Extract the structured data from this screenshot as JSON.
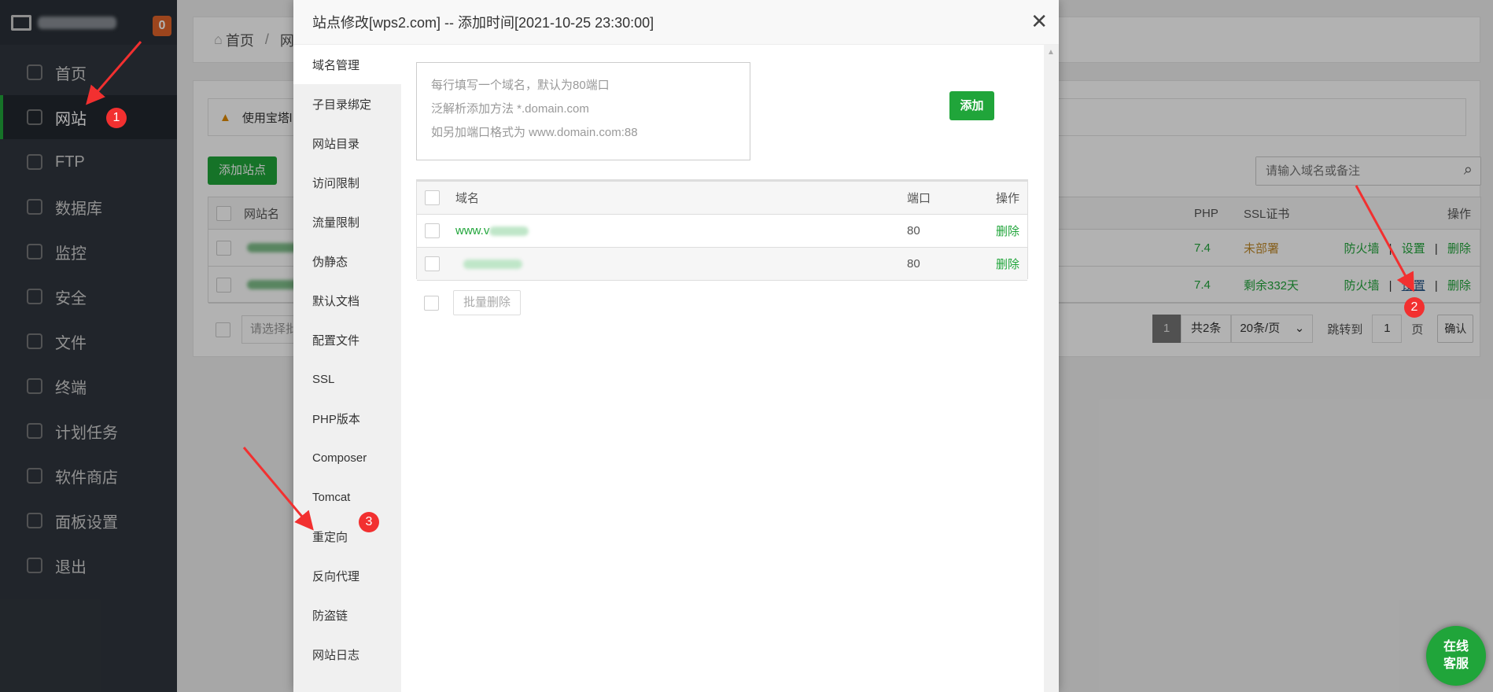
{
  "sidebar": {
    "badge": "0",
    "items": [
      {
        "label": "首页",
        "icon": "home-icon"
      },
      {
        "label": "网站",
        "icon": "globe-icon",
        "active": true
      },
      {
        "label": "FTP",
        "icon": "ftp-icon"
      },
      {
        "label": "数据库",
        "icon": "database-icon"
      },
      {
        "label": "监控",
        "icon": "monitor-icon"
      },
      {
        "label": "安全",
        "icon": "shield-icon"
      },
      {
        "label": "文件",
        "icon": "folder-icon"
      },
      {
        "label": "终端",
        "icon": "terminal-icon"
      },
      {
        "label": "计划任务",
        "icon": "calendar-icon"
      },
      {
        "label": "软件商店",
        "icon": "apps-icon"
      },
      {
        "label": "面板设置",
        "icon": "gear-icon"
      },
      {
        "label": "退出",
        "icon": "logout-icon"
      }
    ]
  },
  "breadcrumb": {
    "home": "首页",
    "sep": "/",
    "current": "网"
  },
  "main": {
    "warning": "使用宝塔l",
    "add_site": "添加站点",
    "search_placeholder": "请输入域名或备注",
    "columns": {
      "name": "网站名",
      "php": "PHP",
      "ssl": "SSL证书",
      "ops": "操作"
    },
    "rows": [
      {
        "php": "7.4",
        "ssl": "未部署",
        "ssl_color": "#c08a2a"
      },
      {
        "php": "7.4",
        "ssl": "剩余332天",
        "ssl_color": "#20a53a"
      }
    ],
    "ops": {
      "firewall": "防火墙",
      "settings": "设置",
      "delete": "删除",
      "sep": "|"
    },
    "batch_placeholder": "请选择批",
    "pagination": {
      "current": "1",
      "total": "共2条",
      "per_page": "20条/页",
      "jump": "跳转到",
      "page_value": "1",
      "page_unit": "页",
      "confirm": "确认"
    }
  },
  "modal": {
    "title": "站点修改[wps2.com] -- 添加时间[2021-10-25 23:30:00]",
    "tabs": [
      "域名管理",
      "子目录绑定",
      "网站目录",
      "访问限制",
      "流量限制",
      "伪静态",
      "默认文档",
      "配置文件",
      "SSL",
      "PHP版本",
      "Composer",
      "Tomcat",
      "重定向",
      "反向代理",
      "防盗链",
      "网站日志"
    ],
    "textarea_hint": [
      "每行填写一个域名，默认为80端口",
      "泛解析添加方法 *.domain.com",
      "如另加端口格式为 www.domain.com:88"
    ],
    "add_button": "添加",
    "columns": {
      "domain": "域名",
      "port": "端口",
      "ops": "操作"
    },
    "rows": [
      {
        "domain": "www.v",
        "port": "80",
        "delete": "删除"
      },
      {
        "domain": "",
        "port": "80",
        "delete": "删除"
      }
    ],
    "batch_delete": "批量删除"
  },
  "annotations": [
    "1",
    "2",
    "3"
  ],
  "chat": {
    "line1": "在线",
    "line2": "客服"
  },
  "colors": {
    "accent": "#20a53a",
    "sidebar": "#30363e",
    "annotation": "#f23030"
  }
}
